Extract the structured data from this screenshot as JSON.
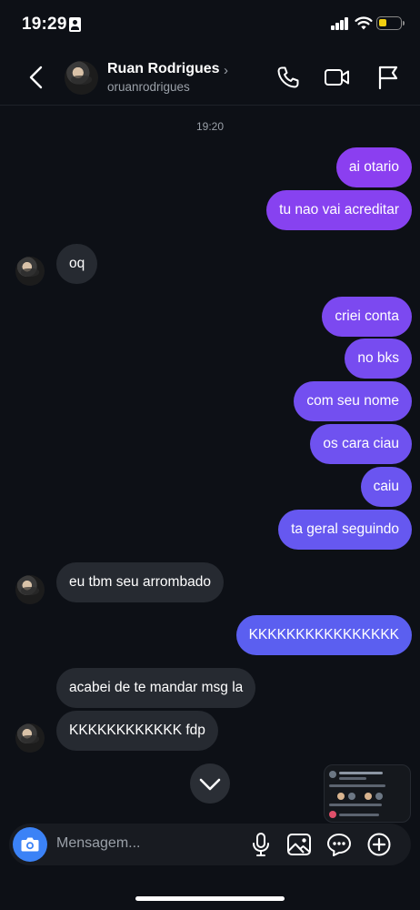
{
  "status_bar": {
    "time": "19:29",
    "battery_level": 0.4
  },
  "header": {
    "name": "Ruan Rodrigues",
    "chevron": "›",
    "handle": "oruanrodrigues",
    "icons": [
      "back-icon",
      "phone-icon",
      "video-icon",
      "flag-icon"
    ]
  },
  "thread": {
    "timestamp": "19:20",
    "messages": [
      {
        "dir": "out",
        "text": "ai otario"
      },
      {
        "dir": "out",
        "text": "tu nao vai acreditar"
      },
      {
        "dir": "in",
        "text": "oq"
      },
      {
        "dir": "out",
        "text": "criei conta"
      },
      {
        "dir": "out",
        "text": "no bks"
      },
      {
        "dir": "out",
        "text": "com seu nome"
      },
      {
        "dir": "out",
        "text": "os cara ciau"
      },
      {
        "dir": "out",
        "text": "caiu"
      },
      {
        "dir": "out",
        "text": "ta geral seguindo"
      },
      {
        "dir": "in",
        "text": "eu tbm seu arrombado"
      },
      {
        "dir": "out",
        "text": "KKKKKKKKKKKKKKKK"
      },
      {
        "dir": "in",
        "text": "acabei de te mandar msg la"
      },
      {
        "dir": "in",
        "text": "KKKKKKKKKKKK fdp"
      }
    ]
  },
  "composer": {
    "placeholder": "Mensagem...",
    "icons": [
      "camera-icon",
      "microphone-icon",
      "gallery-icon",
      "sticker-icon",
      "add-icon"
    ]
  },
  "colors": {
    "background": "#0d1016",
    "incoming_bubble": "#262a31",
    "outgoing_top": "#8b3ff0",
    "outgoing_bottom": "#5b5ff0",
    "camera_button": "#3b82f6"
  }
}
